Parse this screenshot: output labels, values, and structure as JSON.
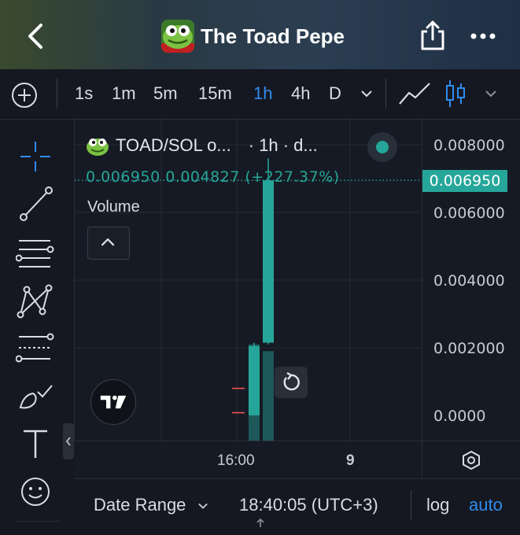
{
  "header": {
    "title": "The Toad Pepe"
  },
  "toolbar": {
    "intervals": [
      "1s",
      "1m",
      "5m",
      "15m",
      "1h",
      "4h",
      "D"
    ],
    "active_interval": "1h"
  },
  "legend": {
    "symbol": "TOAD/SOL o...",
    "interval_info": "· 1h · d...",
    "ohlc": "0.006950  0.004827 (+227.37%)",
    "volume_label": "Volume"
  },
  "price_axis": {
    "labels": [
      "0.008000",
      "0.006000",
      "0.004000",
      "0.002000",
      "0.0000"
    ],
    "last_price": "0.006950"
  },
  "time_axis": {
    "labels": [
      "16:00",
      "9"
    ]
  },
  "bottom_bar": {
    "date_range": "Date Range",
    "clock": "18:40:05 (UTC+3)",
    "log": "log",
    "auto": "auto"
  },
  "colors": {
    "up": "#26a69a",
    "accent": "#2f8bf0",
    "background": "#161a24"
  },
  "chart_data": {
    "type": "candlestick",
    "ylim": [
      0,
      0.008
    ],
    "candles": [
      {
        "open": 0.0,
        "high": 0.00215,
        "low": 0.0,
        "close": 0.00205
      },
      {
        "open": 0.00215,
        "high": 0.0076,
        "low": 0.0021,
        "close": 0.00695
      }
    ],
    "volume": [
      0.0021,
      0.0019
    ],
    "markers": [
      8e-05,
      0.0008
    ]
  }
}
